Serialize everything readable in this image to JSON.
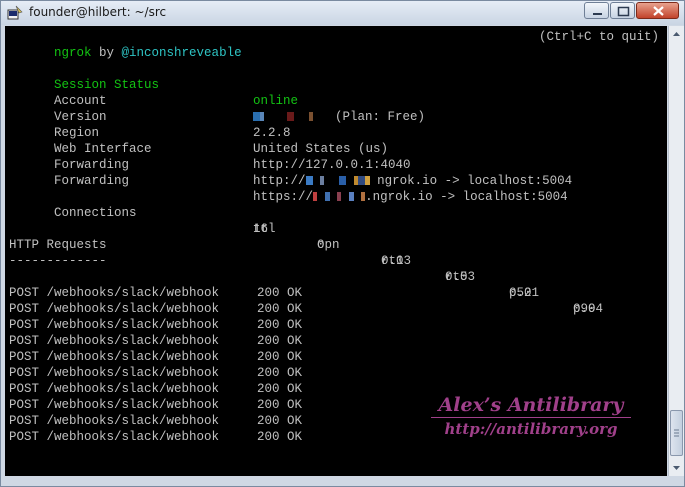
{
  "window": {
    "title": "founder@hilbert: ~/src"
  },
  "header": {
    "left_prefix": "ngrok",
    "left_by": " by ",
    "left_author": "@inconshreveable",
    "right": "(Ctrl+C to quit)"
  },
  "session": {
    "status_label": "Session Status",
    "status_value": "online",
    "account_label": "Account",
    "account_plan": "(Plan: Free)",
    "version_label": "Version",
    "version_value": "2.2.8",
    "region_label": "Region",
    "region_value": "United States (us)",
    "web_label": "Web Interface",
    "web_value": "http://127.0.0.1:4040",
    "fwd1_label": "Forwarding",
    "fwd1_prefix": "http://",
    "fwd1_suffix": "ngrok.io -> localhost:5004",
    "fwd2_label": "Forwarding",
    "fwd2_prefix": "https://",
    "fwd2_suffix": ".ngrok.io -> localhost:5004"
  },
  "connections": {
    "label": "Connections",
    "headers": [
      "ttl",
      "opn",
      "rt1",
      "rt5",
      "p50",
      "p90"
    ],
    "values": [
      "16",
      "0",
      "0.03",
      "0.03",
      "0.21",
      "0.94"
    ]
  },
  "http": {
    "title": "HTTP Requests",
    "underline": "-------------",
    "requests": [
      {
        "method": "POST",
        "path": "/webhooks/slack/webhook",
        "status": "200 OK"
      },
      {
        "method": "POST",
        "path": "/webhooks/slack/webhook",
        "status": "200 OK"
      },
      {
        "method": "POST",
        "path": "/webhooks/slack/webhook",
        "status": "200 OK"
      },
      {
        "method": "POST",
        "path": "/webhooks/slack/webhook",
        "status": "200 OK"
      },
      {
        "method": "POST",
        "path": "/webhooks/slack/webhook",
        "status": "200 OK"
      },
      {
        "method": "POST",
        "path": "/webhooks/slack/webhook",
        "status": "200 OK"
      },
      {
        "method": "POST",
        "path": "/webhooks/slack/webhook",
        "status": "200 OK"
      },
      {
        "method": "POST",
        "path": "/webhooks/slack/webhook",
        "status": "200 OK"
      },
      {
        "method": "POST",
        "path": "/webhooks/slack/webhook",
        "status": "200 OK"
      },
      {
        "method": "POST",
        "path": "/webhooks/slack/webhook",
        "status": "200 OK"
      }
    ]
  },
  "watermark": {
    "title": "Alex’s Antilibrary",
    "url": "http://antilibrary.org"
  },
  "icons": {
    "app": "putty-icon",
    "minimize": "minimize-icon",
    "maximize": "maximize-icon",
    "close": "close-icon"
  },
  "colors": {
    "terminal_bg": "#000000",
    "text": "#c0c0c0",
    "green": "#13c313",
    "cyan": "#2ec4c4",
    "watermark": "#a0408a"
  }
}
